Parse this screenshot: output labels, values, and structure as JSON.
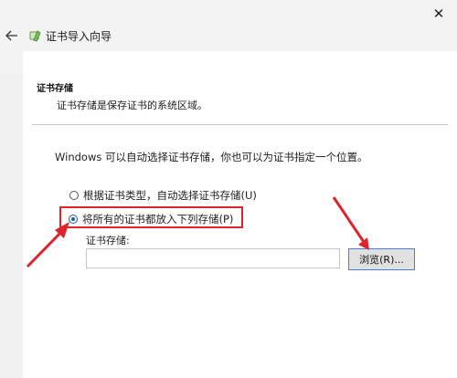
{
  "window": {
    "title": "证书导入向导",
    "close_glyph": "✕",
    "back_glyph": "←"
  },
  "page": {
    "section_title": "证书存储",
    "section_desc": "证书存储是保存证书的系统区域。",
    "instruction": "Windows 可以自动选择证书存储，你也可以为证书指定一个位置。"
  },
  "options": {
    "auto": {
      "label": "根据证书类型，自动选择证书存储(U)",
      "checked": false
    },
    "all": {
      "label": "将所有的证书都放入下列存储(P)",
      "checked": true
    }
  },
  "store": {
    "label": "证书存储:",
    "value": "",
    "browse_label": "浏览(R)..."
  },
  "annotations": {
    "highlight_color": "#e0242b",
    "arrow_color": "#e0242b"
  },
  "colors": {
    "accent": "#1a5fb4",
    "button_border": "#4c7cd6"
  }
}
